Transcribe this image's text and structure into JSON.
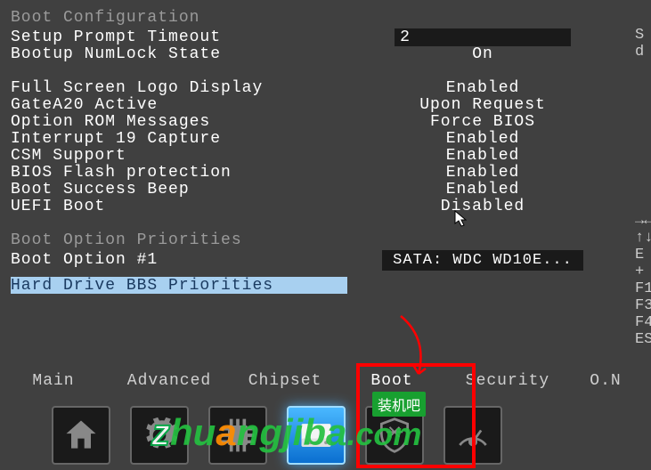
{
  "section_title": "Boot Configuration",
  "settings": [
    {
      "label": "Setup Prompt Timeout",
      "value": "2"
    },
    {
      "label": "Bootup NumLock State",
      "value": "On"
    }
  ],
  "settings2": [
    {
      "label": "Full Screen Logo Display",
      "value": "Enabled"
    },
    {
      "label": "GateA20 Active",
      "value": "Upon Request"
    },
    {
      "label": "Option ROM Messages",
      "value": "Force BIOS"
    },
    {
      "label": "Interrupt 19 Capture",
      "value": "Enabled"
    },
    {
      "label": "CSM Support",
      "value": "Enabled"
    },
    {
      "label": "BIOS Flash protection",
      "value": "Enabled"
    },
    {
      "label": "Boot Success Beep",
      "value": "Enabled"
    },
    {
      "label": "UEFI Boot",
      "value": "Disabled"
    }
  ],
  "priorities_title": "Boot Option Priorities",
  "boot_option": {
    "label": "Boot Option #1",
    "value": "SATA: WDC WD10E..."
  },
  "selected_item": "Hard Drive BBS Priorities",
  "right_hints": [
    "S",
    "d",
    "",
    "",
    "",
    "",
    "",
    "",
    "",
    "",
    "",
    "→←",
    "↑↓",
    "E",
    "+",
    "F1",
    "F3",
    "F4",
    "ES"
  ],
  "nav": {
    "items": [
      {
        "label": "Main"
      },
      {
        "label": "Advanced"
      },
      {
        "label": "Chipset"
      },
      {
        "label": "Boot"
      },
      {
        "label": "Security"
      },
      {
        "label": "O.N"
      }
    ]
  },
  "watermark": {
    "text": "zhuangjiba.com",
    "badge": "装机吧"
  }
}
